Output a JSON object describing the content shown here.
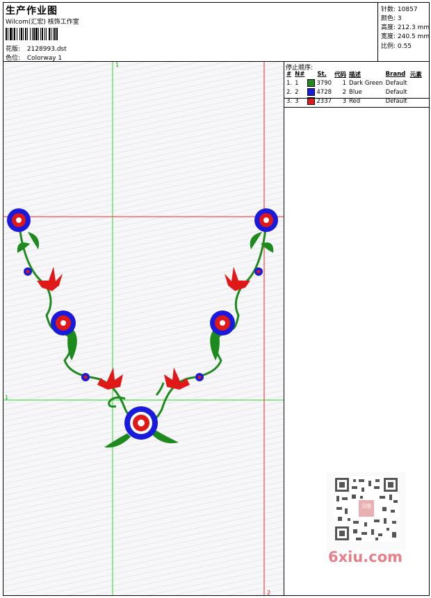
{
  "header": {
    "title": "生产作业图",
    "company": "Wilcom(汇宏) 核饰工作室",
    "design_label": "花版:",
    "design_value": "2128993.dst",
    "color_label": "色位:",
    "color_value": "Colorway 1"
  },
  "stats": {
    "stitches_label": "针数:",
    "stitches_value": "10857",
    "colors_label": "颜色:",
    "colors_value": "3",
    "height_label": "高度:",
    "height_value": "212.3 mm",
    "width_label": "宽度:",
    "width_value": "240.5 mm",
    "scale_label": "比例:",
    "scale_value": "0.55"
  },
  "stop_sequence": {
    "heading": "停止顺序:",
    "columns": [
      "#",
      "N#",
      "St.",
      "代码",
      "描述",
      "Brand",
      "元素"
    ],
    "rows": [
      {
        "seq": "1.",
        "n": "1",
        "st": "3790",
        "code": "1",
        "desc": "Dark Green",
        "brand": "Default",
        "color": "#1c8a1c"
      },
      {
        "seq": "2.",
        "n": "2",
        "st": "4728",
        "code": "2",
        "desc": "Blue",
        "brand": "Default",
        "color": "#1a1adc"
      },
      {
        "seq": "3.",
        "n": "3",
        "st": "2337",
        "code": "3",
        "desc": "Red",
        "brand": "Default",
        "color": "#e01818"
      }
    ]
  },
  "guides": {
    "green_top_label": "1",
    "green_left_label": "1",
    "red_bottom_label": "2"
  },
  "watermark": {
    "text": "6xiu.com",
    "stamp_text": "汉图"
  },
  "colors": {
    "green": "#1c8a1c",
    "blue": "#1a1adc",
    "red": "#e01818",
    "guide_green": "#22dd22",
    "guide_red": "#ee2222"
  }
}
